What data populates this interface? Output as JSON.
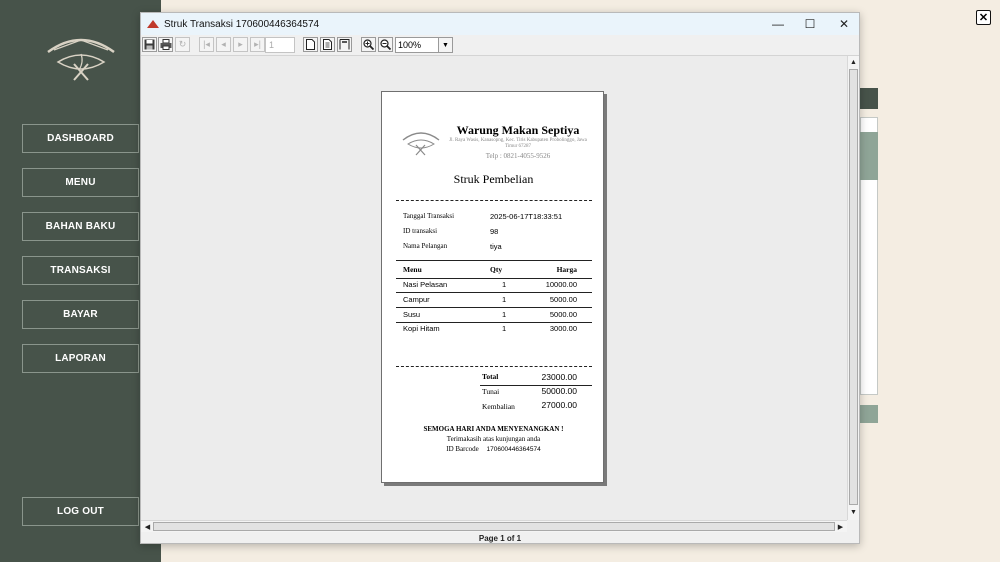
{
  "sidebar": {
    "items": [
      {
        "label": "DASHBOARD"
      },
      {
        "label": "MENU"
      },
      {
        "label": "BAHAN BAKU"
      },
      {
        "label": "TRANSAKSI"
      },
      {
        "label": "BAYAR"
      },
      {
        "label": "LAPORAN"
      }
    ],
    "logout": "LOG OUT"
  },
  "outer_close": "✕",
  "window": {
    "title": "Struk Transaksi 170600446364574",
    "controls": {
      "minimize": "—",
      "maximize": "☐",
      "close": "✕"
    }
  },
  "toolbar": {
    "page_value": "1",
    "zoom": "100%"
  },
  "receipt": {
    "shop_name": "Warung Makan Septiya",
    "address": "Jl. Raya Wasis, Kanasopng, Kec. Tiris Kabupaten Probolinggo, Jawa Timur 67287",
    "phone": "Telp : 0821-4055-9526",
    "title": "Struk Pembelian",
    "info": [
      {
        "label": "Tanggal Transaksi",
        "value": "2025-06-17T18:33:51"
      },
      {
        "label": "ID transaksi",
        "value": "98"
      },
      {
        "label": "Nama Pelangan",
        "value": "tiya"
      }
    ],
    "headers": {
      "menu": "Menu",
      "qty": "Qty",
      "harga": "Harga"
    },
    "items": [
      {
        "menu": "Nasi Pelasan",
        "qty": "1",
        "harga": "10000.00"
      },
      {
        "menu": "Campur",
        "qty": "1",
        "harga": "5000.00"
      },
      {
        "menu": "Susu",
        "qty": "1",
        "harga": "5000.00"
      },
      {
        "menu": "Kopi Hitam",
        "qty": "1",
        "harga": "3000.00"
      }
    ],
    "summary": [
      {
        "label": "Total",
        "value": "23000.00"
      },
      {
        "label": "Tunai",
        "value": "50000.00"
      },
      {
        "label": "Kembalian",
        "value": "27000.00"
      }
    ],
    "greeting": "SEMOGA HARI ANDA MENYENANGKAN !",
    "thanks": "Terimakasih atas kunjungan anda",
    "barcode_label": "ID Barcode",
    "barcode_value": "170600446364574"
  },
  "status": "Page 1 of 1",
  "colors": {
    "sidebar": "#47534a",
    "accent": "#8fa597",
    "background": "#f4ede2"
  }
}
